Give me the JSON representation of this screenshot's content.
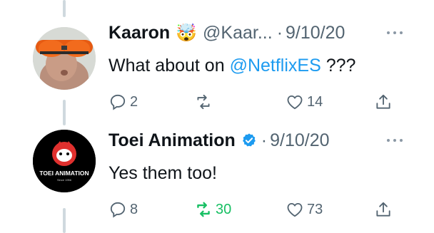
{
  "tweets": [
    {
      "name": "Kaaron",
      "emoji": "🤯",
      "handle": "@Kaar...",
      "separator": "·",
      "date": "9/10/20",
      "text_before": "What about on ",
      "mention": "@NetflixES",
      "text_after": " ???",
      "reply_count": "2",
      "retweet_count": "",
      "like_count": "14",
      "verified": false
    },
    {
      "name": "Toei Animation",
      "separator": "·",
      "date": "9/10/20",
      "text": "Yes them too!",
      "reply_count": "8",
      "retweet_count": "30",
      "like_count": "73",
      "verified": true,
      "retweeted": true,
      "avatar_logo_text": "TOEI ANIMATION",
      "avatar_logo_subtext": "Since 1956"
    }
  ],
  "colors": {
    "link": "#1d9bf0",
    "muted": "#536471",
    "retweet_active": "#17bf63",
    "verified_badge": "#1d9bf0"
  }
}
